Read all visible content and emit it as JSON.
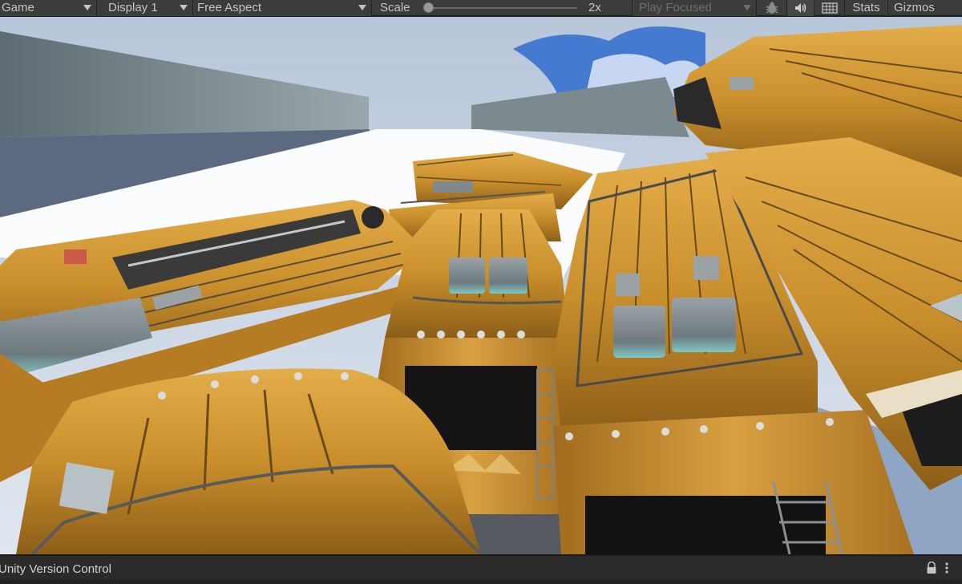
{
  "toolbar": {
    "view_dropdown": "Game",
    "display_dropdown": "Display 1",
    "aspect_dropdown": "Free Aspect",
    "scale_label": "Scale",
    "scale_value": "2x",
    "scale_slider_fraction": 0.0,
    "play_mode_dropdown": "Play Focused",
    "stats_label": "Stats",
    "gizmos_label": "Gizmos",
    "icons": [
      "bug-icon",
      "speaker-icon",
      "grid-icon"
    ]
  },
  "bottom_panel": {
    "title": "Unity Version Control",
    "icons": [
      "lock-icon",
      "more-menu-icon"
    ]
  },
  "colors": {
    "toolbar_bg": "#3c3c3c",
    "panel_bg": "#2b2b2b",
    "text": "#c4c4c4",
    "bus_orange": "#c98f2c",
    "sky": "#9db4d0"
  }
}
